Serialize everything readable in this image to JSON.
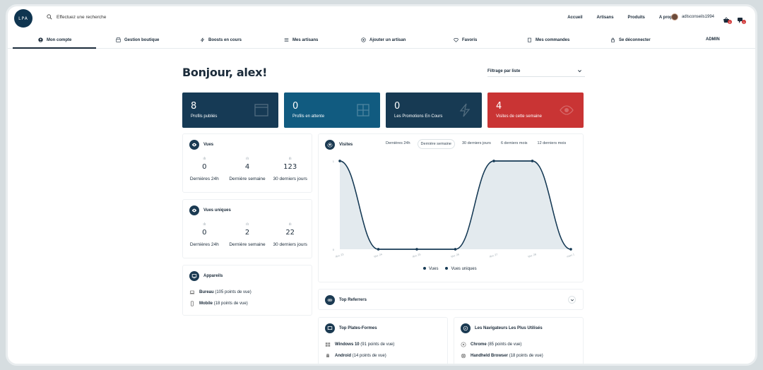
{
  "topbar": {
    "logo": "LPA",
    "search_placeholder": "Effectuez une recherche",
    "nav": [
      "Accueil",
      "Artisans",
      "Produits",
      "A propos"
    ],
    "username": "adlsconseils1994",
    "cart_count": "0",
    "msg_count": "1"
  },
  "subnav": [
    {
      "label": "Mon compte",
      "icon": "user-circle-icon"
    },
    {
      "label": "Gestion boutique",
      "icon": "shop-icon"
    },
    {
      "label": "Boosts en cours",
      "icon": "bolt-icon"
    },
    {
      "label": "Mes artisans",
      "icon": "list-icon"
    },
    {
      "label": "Ajouter un artisan",
      "icon": "plus-circle-icon"
    },
    {
      "label": "Favoris",
      "icon": "heart-icon"
    },
    {
      "label": "Mes commandes",
      "icon": "clipboard-icon"
    },
    {
      "label": "Se déconnecter",
      "icon": "lock-icon"
    },
    {
      "label": "ADMIN",
      "icon": ""
    }
  ],
  "greeting": "Bonjour, alex!",
  "filter_label": "Filtrage par liste",
  "cards": [
    {
      "num": "8",
      "label": "Profils publiés",
      "color": "#163a55"
    },
    {
      "num": "0",
      "label": "Profils en attente",
      "color": "#115b80"
    },
    {
      "num": "0",
      "label": "Les Promotions En Cours",
      "color": "#173a53"
    },
    {
      "num": "4",
      "label": "Visites de cette semaine",
      "color": "#c93434"
    }
  ],
  "vues": {
    "title": "Vues",
    "stats": [
      {
        "v": "0",
        "l": "Dernières 24h"
      },
      {
        "v": "4",
        "l": "Dernière semaine"
      },
      {
        "v": "123",
        "l": "30 derniers jours"
      }
    ]
  },
  "vues_uniques": {
    "title": "Vues uniques",
    "stats": [
      {
        "v": "0",
        "l": "Dernières 24h"
      },
      {
        "v": "2",
        "l": "Dernière semaine"
      },
      {
        "v": "22",
        "l": "30 derniers jours"
      }
    ]
  },
  "appareils": {
    "title": "Appareils",
    "items": [
      {
        "name": "Bureau",
        "detail": "(105 points de vue)"
      },
      {
        "name": "Mobile",
        "detail": "(18 points de vue)"
      }
    ]
  },
  "visites": {
    "title": "Visites",
    "ranges": [
      "Dernières 24h",
      "Dernière semaine",
      "30 derniers jours",
      "6 derniers mois",
      "12 derniers mois"
    ],
    "selected_range": 1,
    "legend": [
      "Vues",
      "Vues uniques"
    ]
  },
  "chart_data": {
    "type": "area",
    "x": [
      "févr. 23",
      "févr. 24",
      "févr. 25",
      "févr. 26",
      "févr. 27",
      "févr. 28",
      "mars 1"
    ],
    "series": [
      {
        "name": "Vues",
        "values": [
          1,
          0,
          0,
          0,
          1,
          1,
          0
        ]
      },
      {
        "name": "Vues uniques",
        "values": [
          1,
          0,
          0,
          0,
          1,
          1,
          0
        ]
      }
    ],
    "yticks": [
      "0",
      "1"
    ],
    "ylim": [
      0,
      1
    ],
    "legend": "bottom"
  },
  "referrers": {
    "title": "Top Referrers"
  },
  "plateformes": {
    "title": "Top Plates-Formes",
    "items": [
      {
        "name": "Windows 10",
        "detail": "(91 points de vue)"
      },
      {
        "name": "Android",
        "detail": "(14 points de vue)"
      }
    ]
  },
  "navigateurs": {
    "title": "Les Navigateurs Les Plus Utilisés",
    "items": [
      {
        "name": "Chrome",
        "detail": "(85 points de vue)"
      },
      {
        "name": "Handheld Browser",
        "detail": "(18 points de vue)"
      }
    ]
  }
}
